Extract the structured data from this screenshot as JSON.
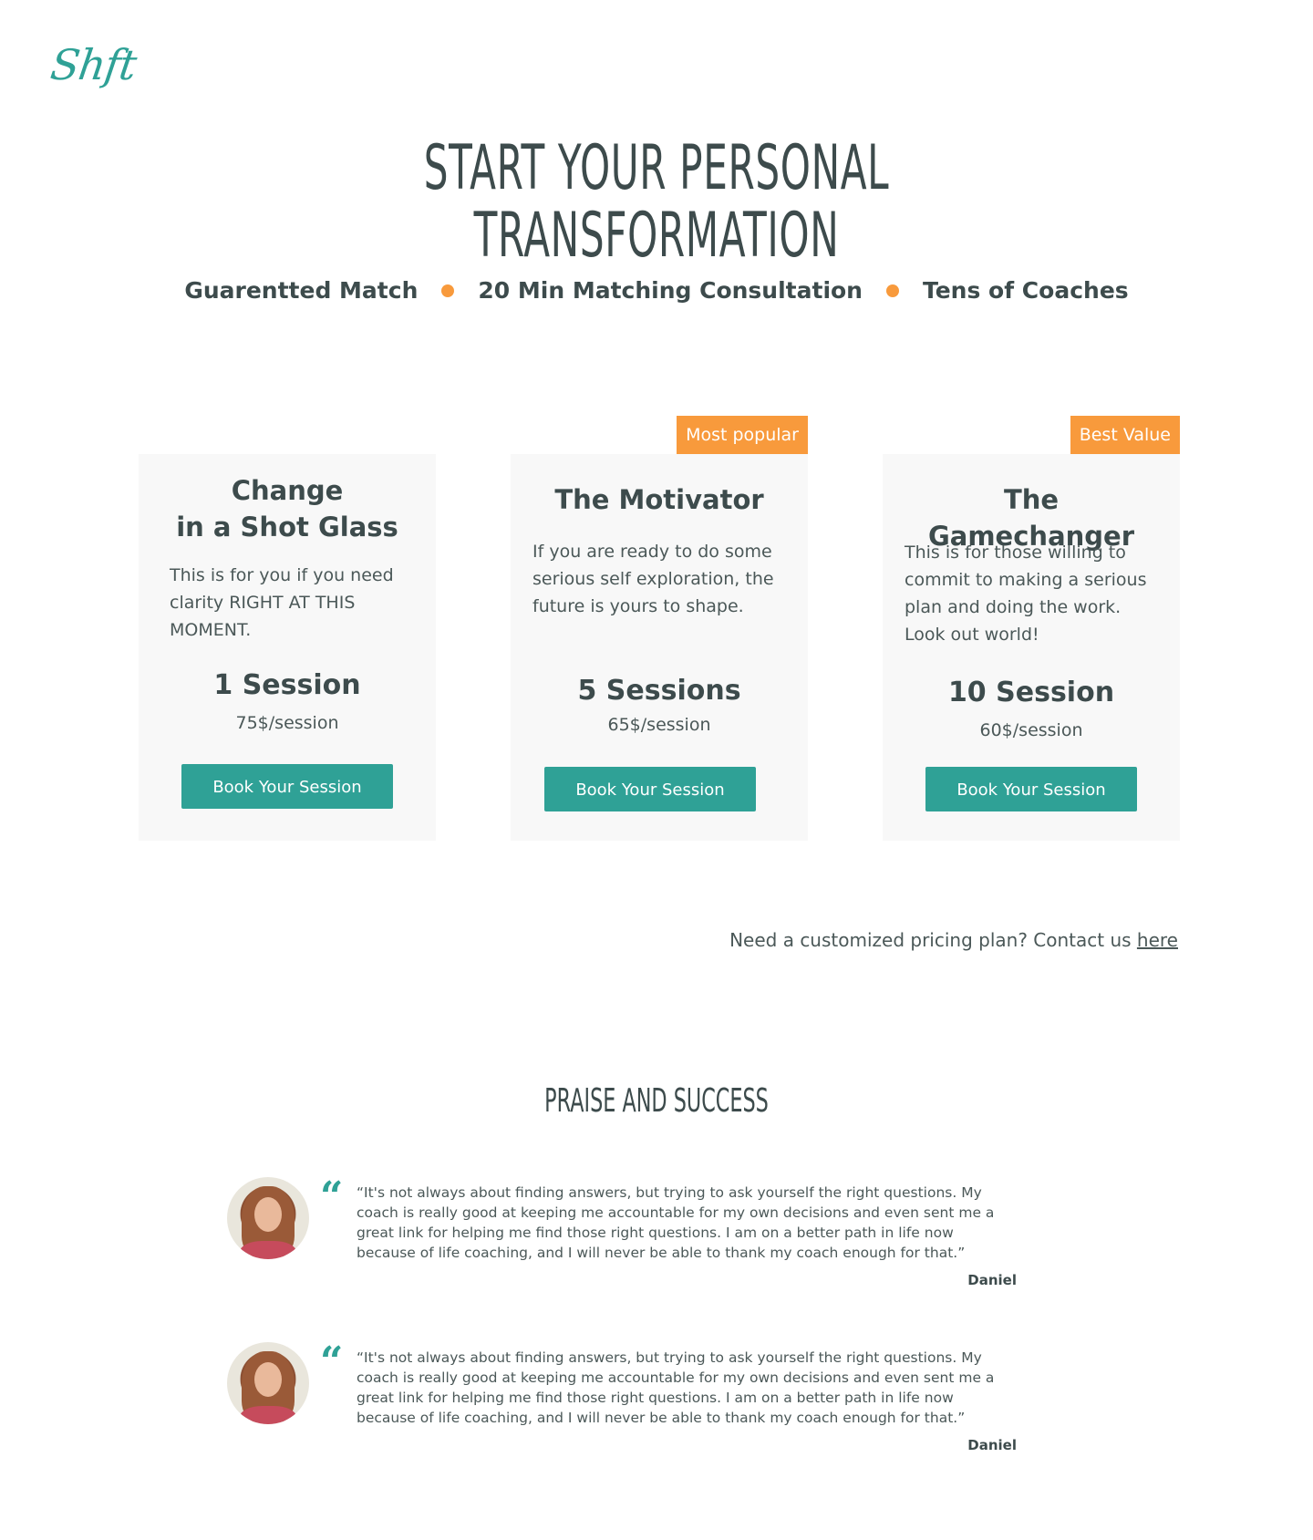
{
  "logo": {
    "text": "Shft",
    "color": "#2fa196"
  },
  "hero": {
    "title": "START YOUR PERSONAL TRANSFORMATION"
  },
  "features": [
    "Guarentted Match",
    "20 Min Matching Consultation",
    "Tens of Coaches"
  ],
  "colors": {
    "accent": "#2fa196",
    "badge": "#f89a3c",
    "text": "#3d4b4c",
    "card_bg": "#f8f8f8"
  },
  "plans": [
    {
      "badge": "",
      "title_line1": "Change",
      "title_line2": "in a Shot Glass",
      "description": "This is for you if you need clarity RIGHT AT THIS MOMENT.",
      "sessions": "1 Session",
      "price": "75$/session",
      "button_label": "Book Your Session"
    },
    {
      "badge": "Most popular",
      "title": "The Motivator",
      "description": "If you are ready to do some serious self exploration, the future is yours to shape.",
      "sessions": "5 Sessions",
      "price": "65$/session",
      "button_label": "Book Your Session"
    },
    {
      "badge": "Best Value",
      "title": "The Gamechanger",
      "description": "This is for those willing to commit to making a serious plan and doing the work. Look out world!",
      "sessions": "10 Session",
      "price": "60$/session",
      "button_label": "Book Your Session"
    }
  ],
  "custom_plan": {
    "text": "Need a customized pricing plan? Contact us ",
    "link_label": "here"
  },
  "praise": {
    "title": "PRAISE AND SUCCESS",
    "quote_icon": "“",
    "testimonials": [
      {
        "quote": "“It's not always about finding answers, but trying to ask yourself the right questions. My coach is really good at keeping me accountable for my own decisions and even sent me a great link for helping me find those right questions. I am on a better path in life now because of life coaching, and I will never be able to thank my coach enough for that.”",
        "author": "Daniel"
      },
      {
        "quote": "“It's not always about finding answers, but trying to ask yourself the right questions. My coach is really good at keeping me accountable for my own decisions and even sent me a great link for helping me find those right questions. I am on a better path in life now because of life coaching, and I will never be able to thank my coach enough for that.”",
        "author": "Daniel"
      }
    ]
  }
}
